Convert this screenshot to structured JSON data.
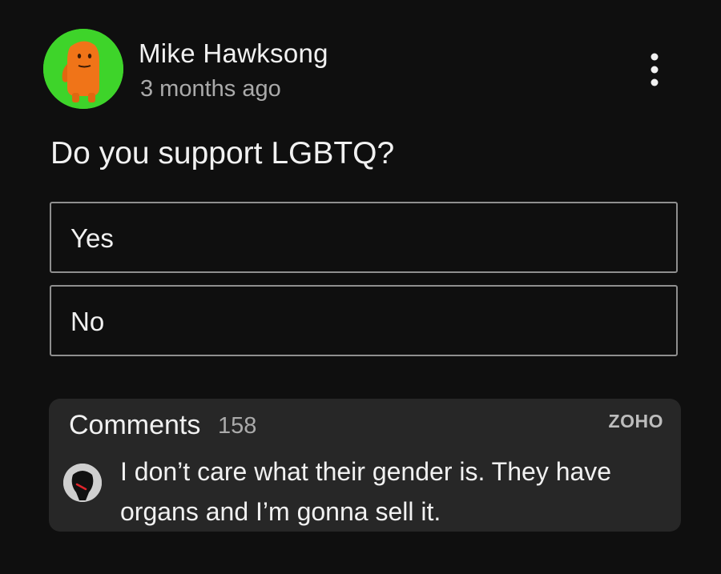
{
  "post": {
    "author": "Mike Hawksong",
    "timestamp": "3 months ago",
    "avatar_icon": "orange-character-avatar",
    "menu_icon": "more-vert-icon"
  },
  "poll": {
    "question": "Do you support LGBTQ?",
    "options": [
      {
        "label": "Yes"
      },
      {
        "label": "No"
      }
    ]
  },
  "comments": {
    "title": "Comments",
    "count": "158",
    "watermark": "ZOHO",
    "top_comment": {
      "avatar_icon": "dark-mask-avatar",
      "text": "I don’t care what their gender is. They have organs and I’m gonna sell it."
    }
  },
  "colors": {
    "background": "#0f0f0f",
    "card": "#272727",
    "option_border": "#8f8f8f",
    "avatar_bg": "#3ed42a",
    "avatar_figure": "#f07418"
  }
}
